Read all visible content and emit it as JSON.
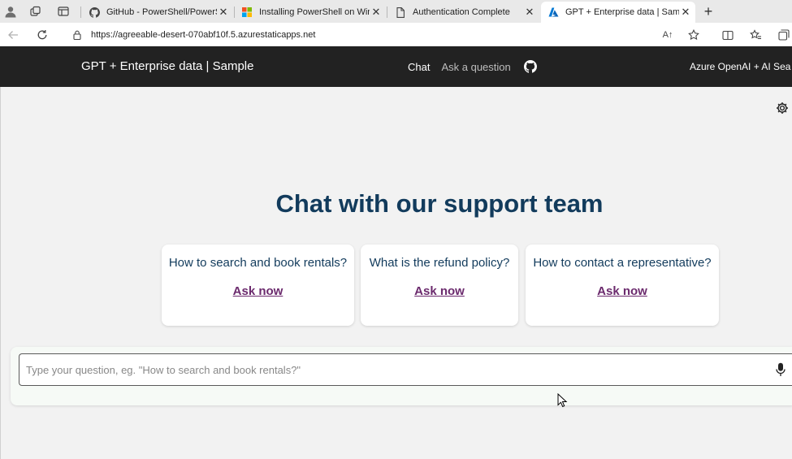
{
  "browser": {
    "tabs": [
      {
        "title": "GitHub - PowerShell/PowerShell",
        "icon": "github-icon",
        "active": false
      },
      {
        "title": "Installing PowerShell on Windows",
        "icon": "microsoft-logo-icon",
        "active": false
      },
      {
        "title": "Authentication Complete",
        "icon": "page-icon",
        "active": false
      },
      {
        "title": "GPT + Enterprise data | Sample",
        "icon": "azure-icon",
        "active": true
      }
    ],
    "url": "https://agreeable-desert-070abf10f.5.azurestaticapps.net",
    "read_aloud_label": "A↑"
  },
  "header": {
    "title": "GPT + Enterprise data | Sample",
    "nav": {
      "chat": "Chat",
      "ask": "Ask a question"
    },
    "right_text": "Azure OpenAI + AI Sea"
  },
  "main": {
    "heading": "Chat with our support team",
    "examples": [
      {
        "question": "How to search and book rentals?",
        "link": "Ask now"
      },
      {
        "question": "What is the refund policy?",
        "link": "Ask now"
      },
      {
        "question": "How to contact a representative?",
        "link": "Ask now"
      }
    ],
    "input_placeholder": "Type your question, eg. \"How to search and book rentals?\""
  },
  "colors": {
    "header_bg": "#222222",
    "heading": "#123b5c",
    "link": "#6b2a6d",
    "page_bg": "#f2f2f2"
  }
}
